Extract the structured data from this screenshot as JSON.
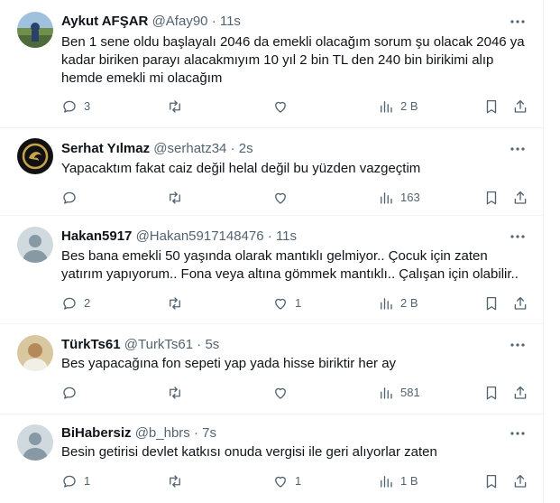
{
  "tweets": [
    {
      "name": "Aykut AFŞAR",
      "handle": "@Afay90",
      "dot": "·",
      "time": "11s",
      "text": "Ben 1 sene oldu başlayalı 2046 da emekli olacağım sorum şu olacak 2046 ya kadar biriken parayı alacakmıyım 10 yıl 2 bin TL den 240 bin birikimi alıp hemde emekli mi olacağım",
      "replies": "3",
      "retweets": "",
      "likes": "",
      "views": "2 B",
      "avatar": "photo-landscape"
    },
    {
      "name": "Serhat Yılmaz",
      "handle": "@serhatz34",
      "dot": "·",
      "time": "2s",
      "text": "Yapacaktım fakat caiz değil helal değil bu yüzden vazgeçtim",
      "replies": "",
      "retweets": "",
      "likes": "",
      "views": "163",
      "avatar": "dark-emblem"
    },
    {
      "name": "Hakan5917",
      "handle": "@Hakan5917148476",
      "dot": "·",
      "time": "11s",
      "text": "Bes bana emekli 50 yaşında olarak mantıklı gelmiyor.. Çocuk için zaten yatırım yapıyorum.. Fona veya altına gömmek mantıklı.. Çalışan için olabilir..",
      "replies": "2",
      "retweets": "",
      "likes": "1",
      "views": "2 B",
      "avatar": "default-profile"
    },
    {
      "name": "TürkTs61",
      "handle": "@TurkTs61",
      "dot": "·",
      "time": "5s",
      "text": "Bes yapacağına fon sepeti yap yada hisse biriktir her ay",
      "replies": "",
      "retweets": "",
      "likes": "",
      "views": "581",
      "avatar": "photo-portrait"
    },
    {
      "name": "BiHabersiz",
      "handle": "@b_hbrs",
      "dot": "·",
      "time": "7s",
      "text": "Besin getirisi devlet katkısı onuda vergisi ile geri alıyorlar zaten",
      "replies": "1",
      "retweets": "",
      "likes": "1",
      "views": "1 B",
      "avatar": "default-profile"
    }
  ],
  "colors": {
    "text": "#0f1419",
    "secondary": "#536471",
    "divider": "#eff3f4"
  },
  "icons": [
    "reply-icon",
    "retweet-icon",
    "like-icon",
    "views-icon",
    "bookmark-icon",
    "share-icon",
    "more-icon"
  ]
}
